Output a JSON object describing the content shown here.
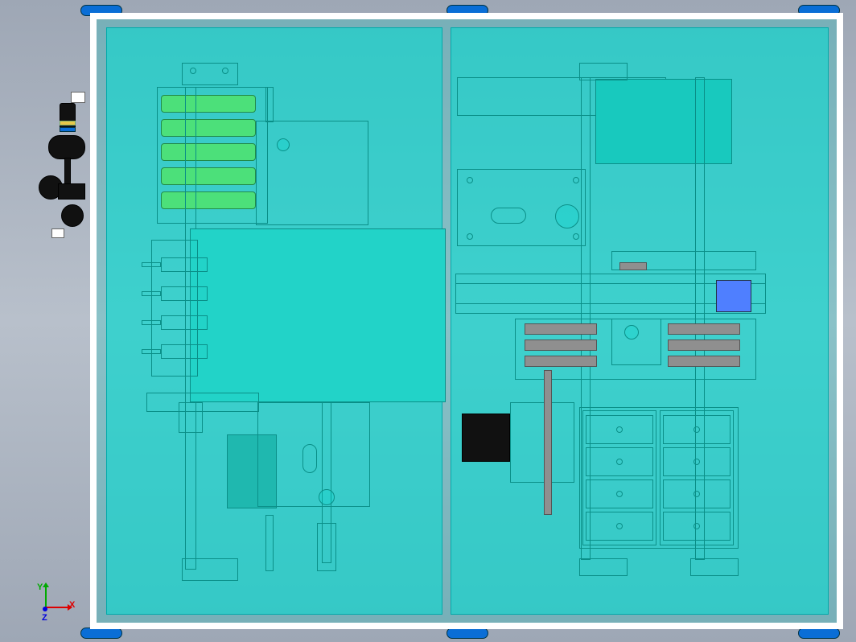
{
  "software_hint": "3D CAD assembly viewport (top orthographic)",
  "axes": {
    "x": "X",
    "y": "Y",
    "z": "Z"
  },
  "colors": {
    "panel": "#22d3c8",
    "frame_border": "#ffffff",
    "green_stack": "#4ce07a",
    "gray_block": "#8f8f8f",
    "blue_accent": "#4f7fff",
    "foot": "#0a6ed6",
    "valve_body": "#111111"
  },
  "components": {
    "outer_frame": "main machine enclosure top panel",
    "glass_left": "left transparent cover",
    "glass_right": "right transparent cover",
    "green_roller_stack": "stacked green rollers x5",
    "left_actuator_stack": "4-gang cylinder manifold",
    "center_block": "main process block",
    "rail_vertical": "linear rail",
    "tray_bank": "right lower pallet 2x4",
    "gray_conveyor": "right middle slat set",
    "pneumatic_tree": "external FRL / valve assembly",
    "leveling_feet": "6 leveling feet"
  }
}
